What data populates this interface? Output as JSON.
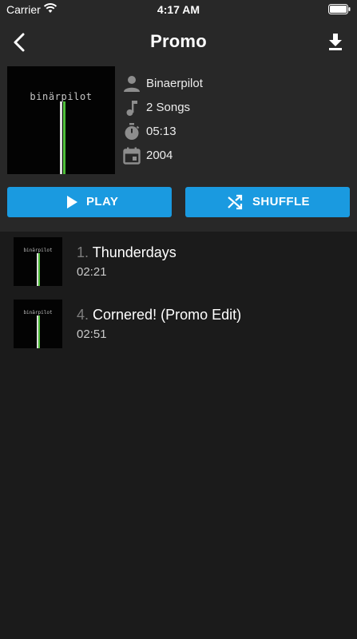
{
  "status_bar": {
    "carrier": "Carrier",
    "time": "4:17 AM"
  },
  "header": {
    "title": "Promo",
    "back_icon": "chevron-left-icon",
    "download_icon": "download-icon"
  },
  "album": {
    "cover_text": "binärpilot",
    "artist": "Binaerpilot",
    "song_count": "2 Songs",
    "duration": "05:13",
    "year": "2004"
  },
  "actions": {
    "play_label": "PLAY",
    "shuffle_label": "SHUFFLE"
  },
  "songs": [
    {
      "number": "1.",
      "title": "Thunderdays",
      "duration": "02:21",
      "cover_text": "binärpilot"
    },
    {
      "number": "4.",
      "title": "Cornered! (Promo Edit)",
      "duration": "02:51",
      "cover_text": "binärpilot"
    }
  ],
  "colors": {
    "accent": "#1a9ae0",
    "header_bg": "#282828",
    "list_bg": "#1b1b1b",
    "cover_line_green": "#4fbf3a",
    "cover_line_white": "#e0e0e0"
  }
}
